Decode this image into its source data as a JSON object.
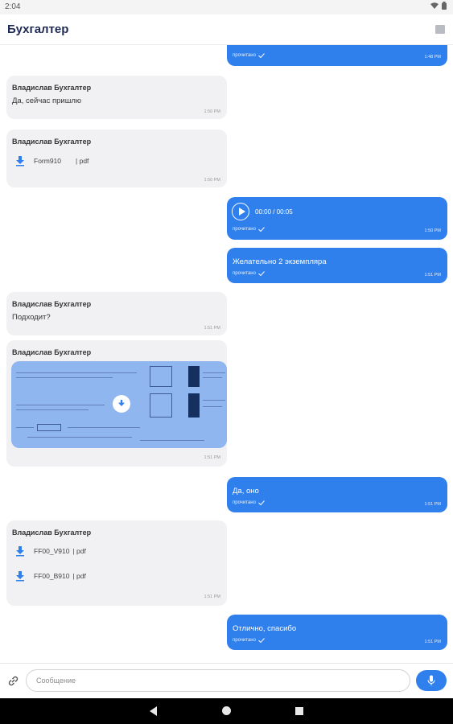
{
  "status_bar": {
    "time": "2:04"
  },
  "header": {
    "title": "Бухгалтер"
  },
  "colors": {
    "accent": "#2f80ed",
    "incoming_bg": "#f1f1f3",
    "title": "#1e2a55"
  },
  "messages": [
    {
      "direction": "out",
      "type": "partial",
      "status": "прочитано",
      "time": "1:48 PM"
    },
    {
      "direction": "in",
      "type": "text",
      "sender": "Владислав Бухгалтер",
      "text": "Да, сейчас пришлю",
      "time": "1:50 PM"
    },
    {
      "direction": "in",
      "type": "files",
      "sender": "Владислав Бухгалтер",
      "files": [
        {
          "name": "Form910",
          "ext": "| pdf"
        }
      ],
      "time": "1:50 PM"
    },
    {
      "direction": "out",
      "type": "audio",
      "duration": "00:00 / 00:05",
      "status": "прочитано",
      "time": "1:50 PM"
    },
    {
      "direction": "out",
      "type": "text",
      "text": "Желательно 2 экземпляра",
      "status": "прочитано",
      "time": "1:51 PM"
    },
    {
      "direction": "in",
      "type": "text",
      "sender": "Владислав Бухгалтер",
      "text": "Подходит?",
      "time": "1:51 PM"
    },
    {
      "direction": "in",
      "type": "image",
      "sender": "Владислав Бухгалтер",
      "time": "1:51 PM"
    },
    {
      "direction": "out",
      "type": "text",
      "text": "Да, оно",
      "status": "прочитано",
      "time": "1:51 PM"
    },
    {
      "direction": "in",
      "type": "files",
      "sender": "Владислав Бухгалтер",
      "files": [
        {
          "name": "FF00_V910",
          "ext": "| pdf"
        },
        {
          "name": "FF00_B910",
          "ext": "| pdf"
        }
      ],
      "time": "1:51 PM"
    },
    {
      "direction": "out",
      "type": "text",
      "text": "Отлично, спасибо",
      "status": "прочитано",
      "time": "1:51 PM"
    }
  ],
  "composer": {
    "placeholder": "Сообщение"
  }
}
